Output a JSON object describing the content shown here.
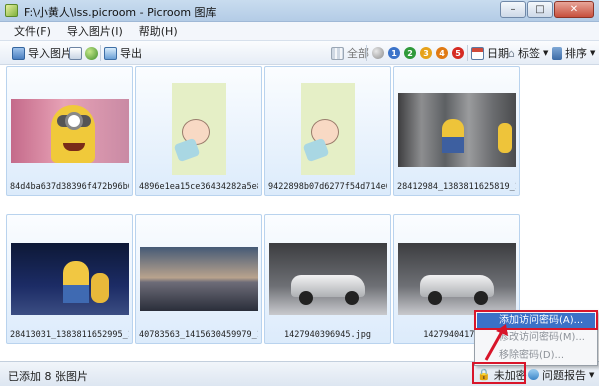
{
  "window": {
    "title": "F:\\小黄人\\lss.picroom - Picroom 图库",
    "controls": {
      "minimize": "–",
      "maximize": "□",
      "close": "✕"
    }
  },
  "menu": [
    "文件(F)",
    "导入图片(I)",
    "帮助(H)"
  ],
  "toolbar": {
    "import_label": "导入图片",
    "export_label": "导出",
    "all_label": "全部",
    "rating_levels": [
      "1",
      "2",
      "3",
      "4",
      "5"
    ],
    "rating_colors": [
      "#3b73c9",
      "#2f9a3a",
      "#e6a21b",
      "#e07a14",
      "#d52b23"
    ],
    "date_label": "日期",
    "tag_label": "标签",
    "sort_label": "排序"
  },
  "thumbnails": [
    {
      "caption": "84d4ba637d38396f472b96b6"
    },
    {
      "caption": "4896e1ea15ce36434282a5e8"
    },
    {
      "caption": "9422898b07d6277f54d714e0"
    },
    {
      "caption": "28412984_1383811625819_1"
    },
    {
      "caption": "28413031_1383811652995_1"
    },
    {
      "caption": "40783563_1415630459979_1"
    },
    {
      "caption": "1427940396945.jpg"
    },
    {
      "caption": "1427940417771"
    }
  ],
  "status": {
    "count_text": "已添加 8 张图片",
    "encrypt_label": "未加密",
    "report_label": "问题报告"
  },
  "popup": {
    "items": [
      "添加访问密码(A)...",
      "修改访问密码(M)...",
      "移除密码(D)..."
    ]
  }
}
